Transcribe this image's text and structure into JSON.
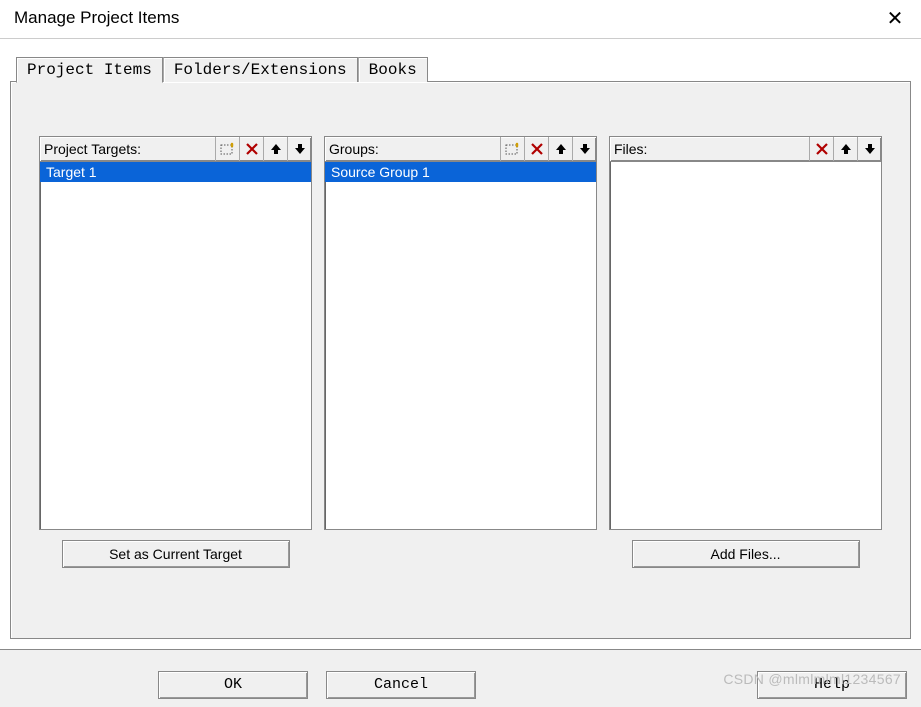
{
  "window": {
    "title": "Manage Project Items"
  },
  "tabs": [
    {
      "label": "Project Items",
      "active": true
    },
    {
      "label": "Folders/Extensions",
      "active": false
    },
    {
      "label": "Books",
      "active": false
    }
  ],
  "panels": {
    "targets": {
      "label": "Project Targets:",
      "items": [
        "Target 1"
      ],
      "button": "Set as Current Target",
      "has_new": true
    },
    "groups": {
      "label": "Groups:",
      "items": [
        "Source Group 1"
      ],
      "has_new": true
    },
    "files": {
      "label": "Files:",
      "items": [],
      "button": "Add Files...",
      "has_new": false
    }
  },
  "buttons": {
    "ok": "OK",
    "cancel": "Cancel",
    "help": "Help"
  },
  "watermark": "CSDN @mlmlmlml1234567"
}
